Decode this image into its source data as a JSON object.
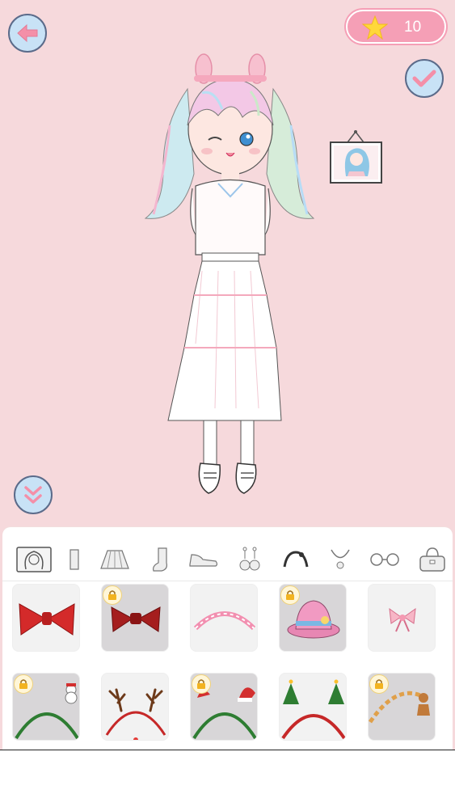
{
  "header": {
    "stars": "10",
    "back_icon": "arrow-left-icon",
    "confirm_icon": "checkmark-icon",
    "collapse_icon": "double-chevron-down-icon"
  },
  "colors": {
    "background": "#f6d9dc",
    "button_fill": "#c8e2f6",
    "accent_pink": "#f59fb6"
  },
  "categories": [
    {
      "name": "hair-tab",
      "icon": "hairstyle-icon",
      "selected": true
    },
    {
      "name": "top-tab",
      "icon": "shirt-icon"
    },
    {
      "name": "skirt-tab",
      "icon": "skirt-icon"
    },
    {
      "name": "socks-tab",
      "icon": "sock-icon"
    },
    {
      "name": "shoes-tab",
      "icon": "sneaker-icon"
    },
    {
      "name": "earrings-tab",
      "icon": "earrings-icon"
    },
    {
      "name": "headband-tab",
      "icon": "headband-icon",
      "active": true
    },
    {
      "name": "necklace-tab",
      "icon": "necklace-icon"
    },
    {
      "name": "glasses-tab",
      "icon": "glasses-icon"
    },
    {
      "name": "bag-tab",
      "icon": "handbag-icon"
    }
  ],
  "items": [
    {
      "name": "red-bow-item",
      "locked": false
    },
    {
      "name": "dark-red-bow-item",
      "locked": true
    },
    {
      "name": "pink-headband-item",
      "locked": false
    },
    {
      "name": "pink-hat-item",
      "locked": true
    },
    {
      "name": "small-pink-bow-item",
      "locked": false
    },
    {
      "name": "snowman-headband-item",
      "locked": true
    },
    {
      "name": "antler-headband-item",
      "locked": false
    },
    {
      "name": "santa-hat-headband-item",
      "locked": true
    },
    {
      "name": "tree-headband-item",
      "locked": false
    },
    {
      "name": "gingerbread-headband-item",
      "locked": true
    }
  ]
}
